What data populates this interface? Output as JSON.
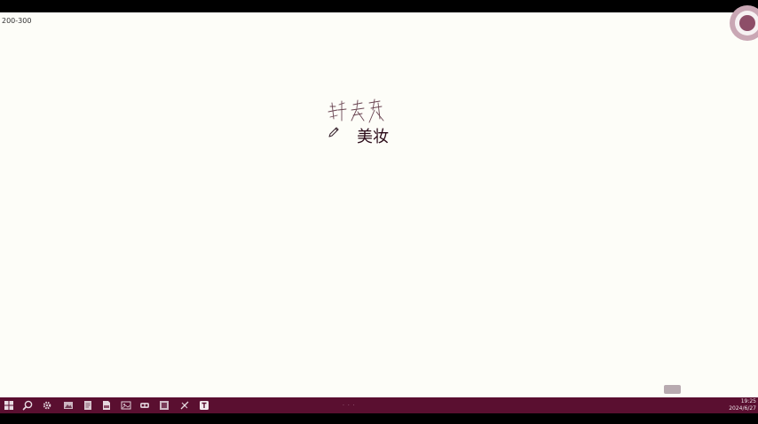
{
  "corner_label": "200-300",
  "note": {
    "handwritten_text": "评美妆",
    "typed_text": "美妆"
  },
  "taskbar": {
    "icons": [
      "start-windows-icon",
      "search-icon",
      "settings-gear-icon",
      "photos-icon",
      "notes-icon",
      "document-icon",
      "image-viewer-icon",
      "mixed-reality-icon",
      "gallery-icon",
      "sketch-tool-icon",
      "text-app-icon"
    ]
  },
  "clock": {
    "time": "19:25",
    "date": "2024/6/27"
  },
  "colors": {
    "canvas_bg": "#fdfdf8",
    "taskbar_bg": "#5a0f30",
    "ink": "#2a0a18",
    "accent": "#8d4e68"
  }
}
